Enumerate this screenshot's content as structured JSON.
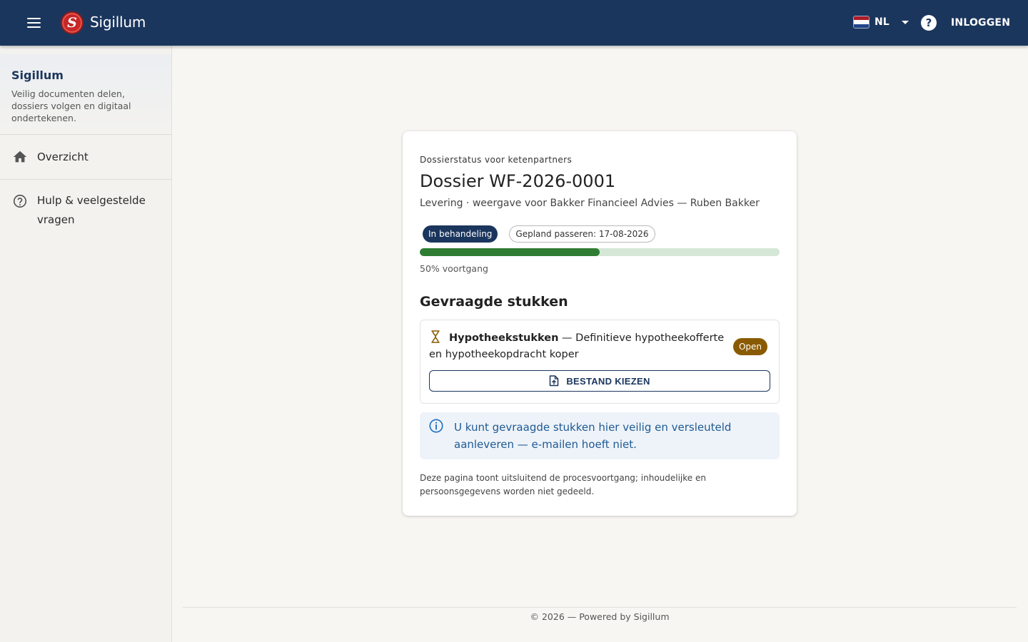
{
  "topbar": {
    "brand": "Sigillum",
    "logo_letter": "S",
    "language": "NL",
    "login_label": "INLOGGEN",
    "help_symbol": "?",
    "bg_color": "#1b365d"
  },
  "sidebar": {
    "title": "Sigillum",
    "description": "Veilig documenten delen, dossiers volgen en digitaal ondertekenen.",
    "items": [
      {
        "label": "Overzicht",
        "icon": "home-icon"
      },
      {
        "label": "Hulp & veelgestelde vragen",
        "icon": "help-circle-icon"
      }
    ]
  },
  "card": {
    "eyebrow": "Dossierstatus voor ketenpartners",
    "title": "Dossier WF-2026-0001",
    "subtitle": "Levering · weergave voor Bakker Financieel Advies — Ruben Bakker",
    "status_chip": "In behandeling",
    "date_chip": "Gepland passeren: 17-08-2026",
    "progress_percent": 50,
    "progress_label": "50% voortgang",
    "section_title": "Gevraagde stukken",
    "request": {
      "name": "Hypotheekstukken",
      "description": " — Definitieve hypotheekofferte en hypotheekopdracht koper",
      "badge": "Open",
      "button_label": "BESTAND KIEZEN"
    },
    "info_text": "U kunt gevraagde stukken hier veilig en versleuteld aanleveren — e-mailen hoeft niet.",
    "footnote": "Deze pagina toont uitsluitend de procesvoortgang; inhoudelijke en persoonsgegevens worden niet gedeeld."
  },
  "footer": {
    "text": "© 2026 — Powered by Sigillum"
  },
  "colors": {
    "primary": "#1b365d",
    "progress": "#2e7d32",
    "progress_track": "#d5e7d6",
    "badge_open": "#8a5a00",
    "info_text": "#1e5a94"
  }
}
